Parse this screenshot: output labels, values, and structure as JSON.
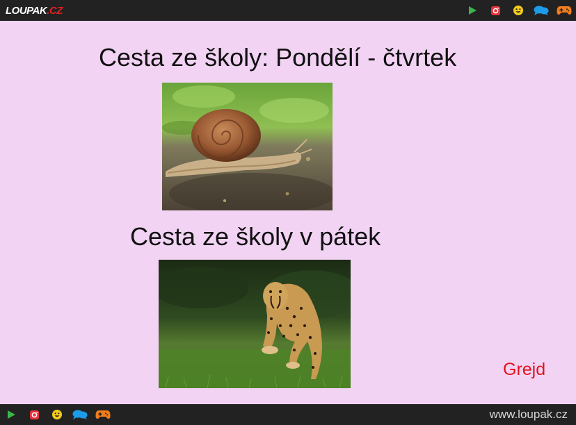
{
  "header": {
    "logo_main": "LOUPAK",
    "logo_tld": ".CZ",
    "icons": [
      "play-icon",
      "instagram-icon",
      "smiley-icon",
      "chat-icon",
      "gamepad-icon"
    ]
  },
  "main": {
    "title_weekdays": "Cesta ze školy: Pondělí - čtvrtek",
    "title_friday": "Cesta ze školy v pátek",
    "signature": "Grejd"
  },
  "footer": {
    "url": "www.loupak.cz",
    "icons": [
      "play-icon",
      "instagram-icon",
      "smiley-icon",
      "chat-icon",
      "gamepad-icon"
    ]
  },
  "colors": {
    "background": "#f2d3f4",
    "bar": "#222223",
    "signature": "#e0141e",
    "play": "#3cb44a",
    "instagram": "#e8313a",
    "smiley": "#f5cc19",
    "chat": "#1e9be8",
    "gamepad": "#f07c1c"
  }
}
